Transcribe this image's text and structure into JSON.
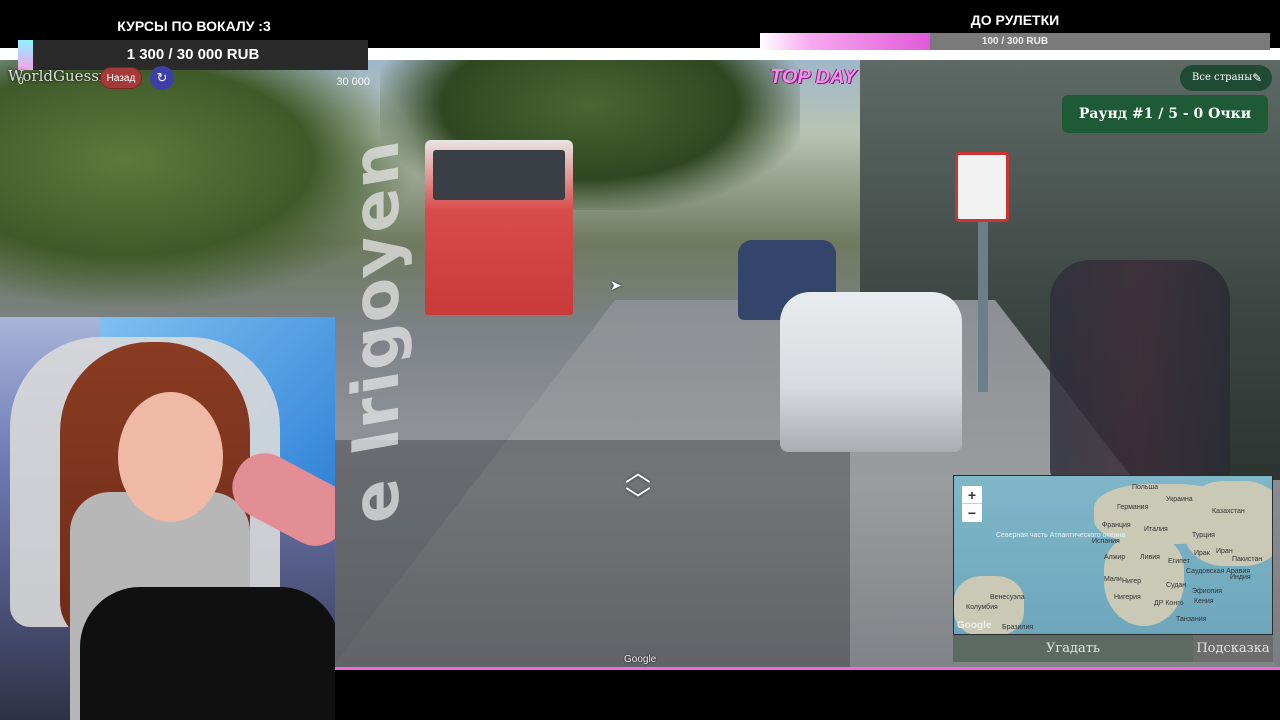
{
  "vocal_goal": {
    "title": "КУРСЫ ПО ВОКАЛУ :3",
    "amount_text": "1 300 / 30 000 RUB",
    "progress": 0.043,
    "min_label": "0",
    "max_label": "30 000"
  },
  "roulette_goal": {
    "title": "ДО РУЛЕТКИ",
    "amount_text": "100 / 300 RUB",
    "progress": 0.333
  },
  "game": {
    "logo": "WorldGuessr",
    "back_label": "Назад",
    "refresh_icon": "refresh-icon",
    "top_day_label": "TOP DAY",
    "all_countries_label": "Все страны",
    "round_text": "Раунд #1 / 5 - 0 Очки",
    "guess_label": "Угадать",
    "hint_label": "Подсказка"
  },
  "street_view": {
    "street_name": "e Irigoyen",
    "attribution": "Google",
    "nav_up_icon": "chevron-up-icon",
    "nav_down_icon": "chevron-down-icon"
  },
  "minimap": {
    "zoom_in": "+",
    "zoom_out": "−",
    "ocean_label": "Северная часть Атлантического океана",
    "labels": [
      "Польша",
      "Германия",
      "Украина",
      "Казахстан",
      "Франция",
      "Италия",
      "Турция",
      "Испания",
      "Алжир",
      "Ливия",
      "Египет",
      "Ирак",
      "Иран",
      "Пакистан",
      "Саудовская Аравия",
      "Мали",
      "Нигер",
      "Судан",
      "Индия",
      "Эфиопия",
      "Нигерия",
      "ДР Конго",
      "Кения",
      "Танзания",
      "Венесуэла",
      "Колумбия",
      "Бразилия"
    ],
    "google_mark": "Google"
  },
  "colors": {
    "accent_pink": "#f06ad8",
    "round_green": "#1e5a36",
    "back_red": "#a53a3a"
  }
}
